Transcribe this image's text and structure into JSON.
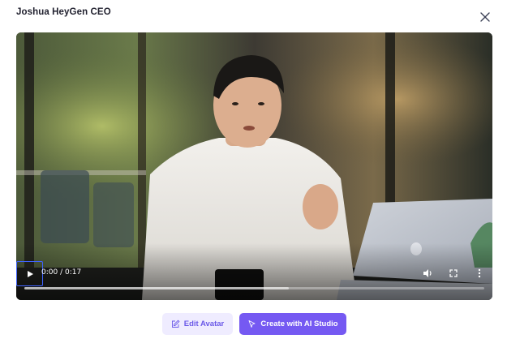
{
  "dialog": {
    "title": "Joshua HeyGen CEO",
    "close_icon": "close-icon"
  },
  "video": {
    "time_display": "0:00 / 0:17",
    "play_icon": "play-icon",
    "volume_icon": "volume-icon",
    "fullscreen_icon": "fullscreen-icon",
    "more_icon": "more-vertical-icon",
    "played_fraction": 0.0,
    "buffered_fraction": 0.575
  },
  "actions": {
    "edit_label": "Edit Avatar",
    "edit_icon": "edit-icon",
    "create_label": "Create with AI Studio",
    "create_icon": "cursor-icon"
  },
  "colors": {
    "accent": "#7559f2",
    "accent_light": "#efecff",
    "focus_ring": "#3f63ff"
  }
}
